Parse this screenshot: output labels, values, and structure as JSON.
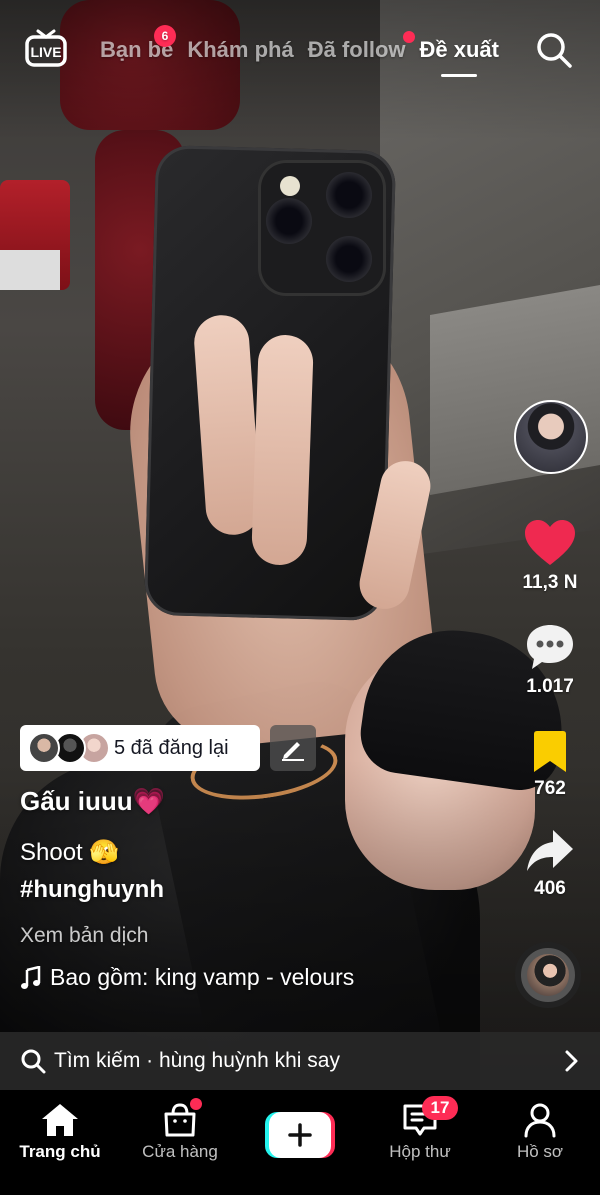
{
  "top_nav": {
    "live_label": "LIVE",
    "tabs": [
      {
        "label": "Bạn bè",
        "badge": "6"
      },
      {
        "label": "Khám phá"
      },
      {
        "label": "Đã follow",
        "dot": true
      },
      {
        "label": "Đề xuất",
        "active": true
      }
    ],
    "search_icon": "search-icon"
  },
  "rail": {
    "likes": "11,3 N",
    "comments": "1.017",
    "saves": "762",
    "shares": "406"
  },
  "post": {
    "repost_text": "5 đã đăng lại",
    "username": "Gấu iuuu💗",
    "caption": "Shoot 🫣",
    "hashtag": "#hunghuynh",
    "translate": "Xem bản dịch",
    "music": "Bao gồm: king vamp - velours"
  },
  "search_suggestion": {
    "text": "Tìm kiếm · hùng huỳnh khi say"
  },
  "bottom_nav": {
    "items": [
      {
        "label": "Trang chủ",
        "icon": "home-icon",
        "active": true
      },
      {
        "label": "Cửa hàng",
        "icon": "shop-bag-icon",
        "dot": true
      },
      {
        "label": "",
        "icon": "create-plus-icon"
      },
      {
        "label": "Hộp thư",
        "icon": "inbox-icon",
        "badge": "17"
      },
      {
        "label": "Hồ sơ",
        "icon": "profile-icon"
      }
    ]
  },
  "colors": {
    "accent_red": "#fe2c55",
    "like_red": "#ef2950",
    "save_yellow": "#facd00",
    "teal": "#25f4ee"
  }
}
